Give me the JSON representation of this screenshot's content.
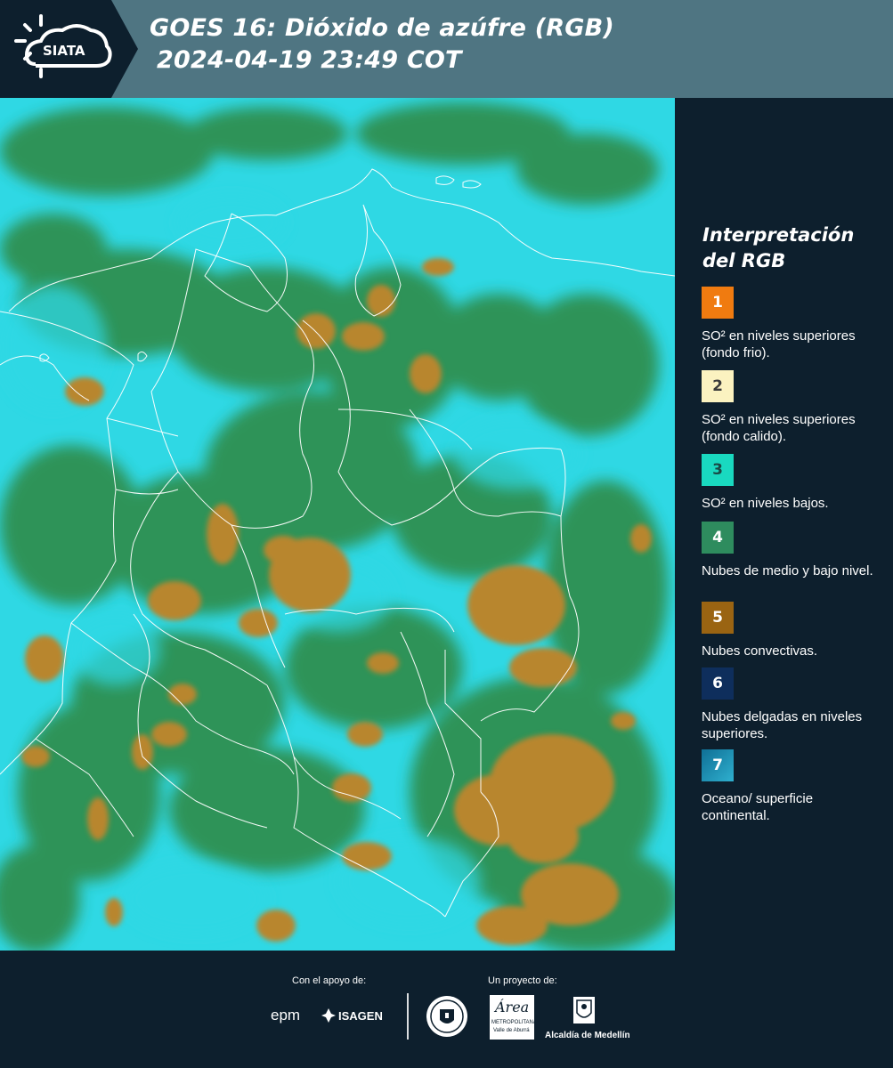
{
  "header": {
    "logo_text": "SIATA",
    "title_line1": "GOES 16: Dióxido de azúfre (RGB)",
    "title_line2": "2024-04-19 23:49 COT"
  },
  "legend": {
    "title": "Interpretación del RGB",
    "items": [
      {
        "number": "1",
        "color": "#f07b10",
        "text": "SO² en niveles superiores (fondo frio)."
      },
      {
        "number": "2",
        "color": "#fbf2c0",
        "text": "SO² en niveles superiores (fondo calido)."
      },
      {
        "number": "3",
        "color": "#19d9c0",
        "text": "SO² en niveles bajos."
      },
      {
        "number": "4",
        "color": "#2e8c5e",
        "text": "Nubes de medio y bajo nivel."
      },
      {
        "number": "5",
        "color": "#9a6412",
        "text": "Nubes convectivas."
      },
      {
        "number": "6",
        "color": "#0e2e5c",
        "text": "Nubes delgadas en niveles superiores."
      },
      {
        "number": "7",
        "color": "#1d8fb3",
        "text": "Oceano/ superficie continental."
      }
    ]
  },
  "footer": {
    "support_label": "Con el apoyo de:",
    "project_label": "Un proyecto de:",
    "sponsor_epm": "epm",
    "sponsor_isagen": "ISAGEN",
    "partner_area_line1": "METROPOLITANA",
    "partner_area_line2": "Valle de Aburrá",
    "partner_area_script": "Área",
    "partner_alcaldia": "Alcaldía de Medellín"
  },
  "map_colors": {
    "background": "#2fd8e4",
    "cloud_green": "#2f8c48",
    "cloud_brown": "#b8862e",
    "borders": "#ffffff"
  }
}
